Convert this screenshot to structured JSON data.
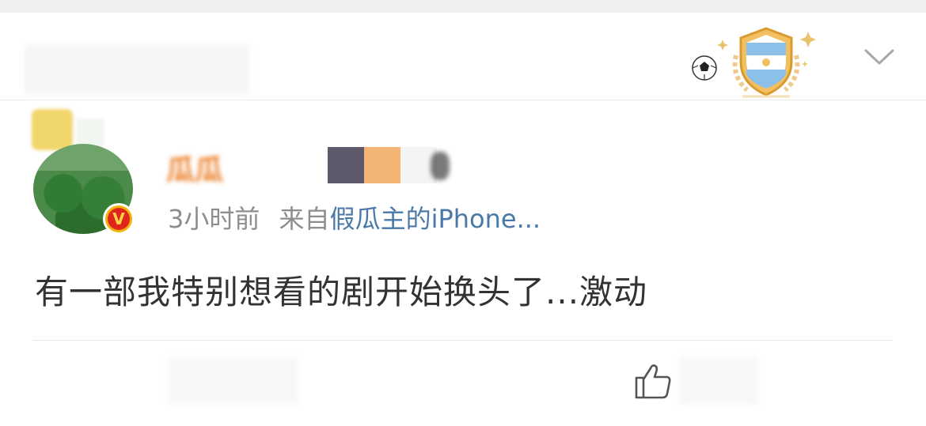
{
  "post": {
    "timestamp": "3小时前",
    "source_prefix": "来自",
    "source": "假瓜主的iPhone...",
    "content": "有一部我特别想看的剧开始换头了...激动",
    "verified_badge": "V"
  },
  "icons": {
    "header_badge": "argentina-football-fan-badge-icon",
    "expand": "chevron-down-icon",
    "like": "thumbs-up-icon"
  },
  "colors": {
    "source_link": "#4a79a8",
    "meta_text": "#8d8d8d",
    "verified_badge": "#e0261c"
  }
}
